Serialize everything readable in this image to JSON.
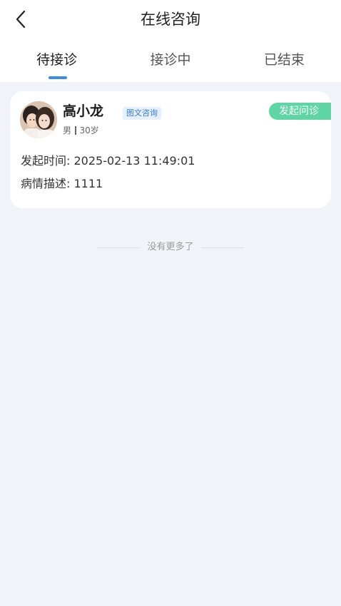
{
  "header": {
    "title": "在线咨询",
    "back_icon": "chevron-left-icon"
  },
  "tabs": [
    {
      "label": "待接诊",
      "active": true
    },
    {
      "label": "接诊中",
      "active": false
    },
    {
      "label": "已结束",
      "active": false
    }
  ],
  "colors": {
    "accent": "#3a8bf0",
    "status_badge": "#5fd4a4",
    "background": "#f0f4f9"
  },
  "consultation": {
    "patient_name": "高小龙",
    "type_badge": "图文咨询",
    "gender": "男",
    "age": "30岁",
    "status_label": "发起问诊",
    "time_label": "发起时间:",
    "time_value": "2025-02-13 11:49:01",
    "description_label": "病情描述:",
    "description_value": "1111"
  },
  "list_footer": "没有更多了"
}
